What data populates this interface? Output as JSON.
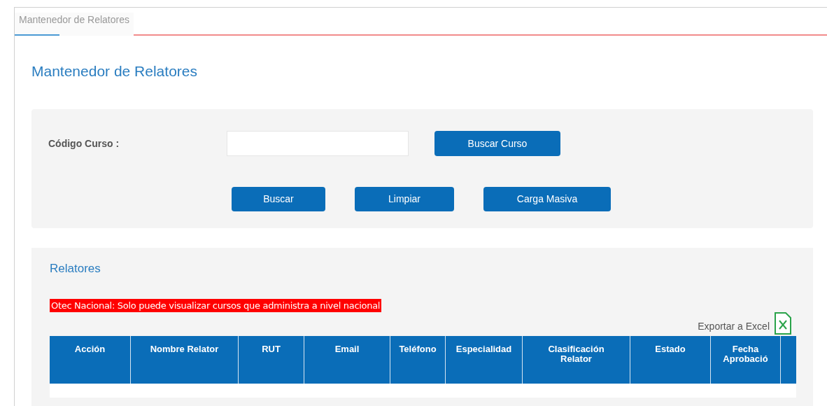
{
  "tabs": [
    {
      "label": "Mantenedor de Relatores",
      "selected": true
    }
  ],
  "page_title": "Mantenedor de Relatores",
  "search_form": {
    "course_code_label": "Código Curso :",
    "search_course_button": "Buscar Curso",
    "buttons": [
      "Buscar",
      "Limpiar",
      "Carga Masiva"
    ]
  },
  "results": {
    "title": "Relatores",
    "alert": "Otec Nacional: Solo puede visualizar cursos que administra a nivel nacional",
    "export_link": "Exportar a Excel",
    "table": {
      "columns": [
        "Acción",
        "Nombre Relator",
        "RUT",
        "Email",
        "Teléfono",
        "Especialidad",
        "Clasificación Relator",
        "Estado",
        "Fecha Aprobació"
      ]
    }
  }
}
